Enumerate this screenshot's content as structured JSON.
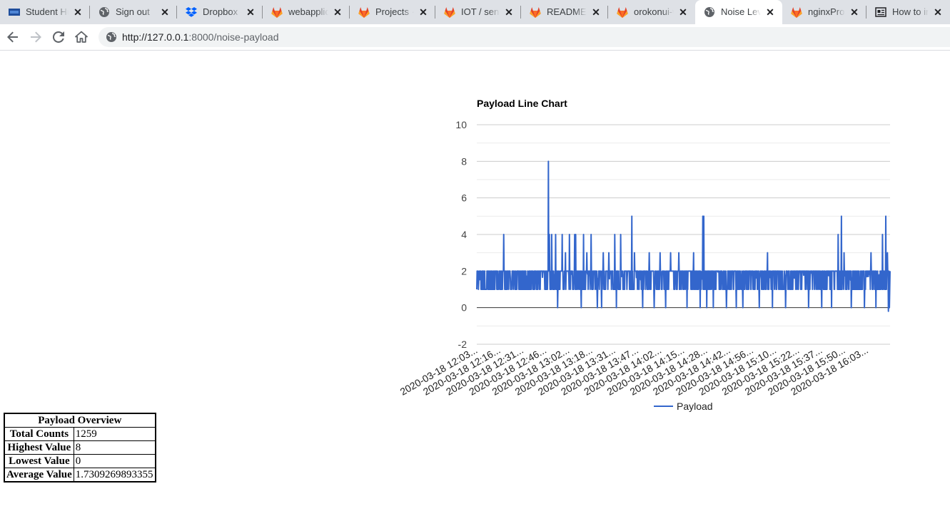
{
  "tabs": [
    {
      "title": "Student Hub",
      "icon": "student-hub-icon"
    },
    {
      "title": "Sign out",
      "icon": "globe-icon"
    },
    {
      "title": "Dropbox - ",
      "icon": "dropbox-icon"
    },
    {
      "title": "webapplication",
      "icon": "gitlab-icon"
    },
    {
      "title": "Projects · Dashboard",
      "icon": "gitlab-icon"
    },
    {
      "title": "IOT / sensor",
      "icon": "gitlab-icon"
    },
    {
      "title": "README.md",
      "icon": "gitlab-icon"
    },
    {
      "title": "orokonui-web",
      "icon": "gitlab-icon"
    },
    {
      "title": "Noise Level",
      "icon": "globe-icon",
      "active": true
    },
    {
      "title": "nginxProxy",
      "icon": "gitlab-icon"
    },
    {
      "title": "How to install",
      "icon": "reader-icon"
    }
  ],
  "address": {
    "host": "http://127.0.0.1",
    "path": ":8000/noise-payload"
  },
  "chart_data": {
    "type": "line",
    "title": "Payload Line Chart",
    "ylim": [
      -2,
      10
    ],
    "yticks": [
      "10",
      "8",
      "6",
      "4",
      "2",
      "0",
      "-2"
    ],
    "grid": true,
    "legend_position": "bottom",
    "x_tick_labels": [
      "2020-03-18 12:03...",
      "2020-03-18 12:16...",
      "2020-03-18 12:31...",
      "2020-03-18 12:46...",
      "2020-03-18 13:02...",
      "2020-03-18 13:18...",
      "2020-03-18 13:31...",
      "2020-03-18 13:47...",
      "2020-03-18 14:02...",
      "2020-03-18 14:15...",
      "2020-03-18 14:28...",
      "2020-03-18 14:42...",
      "2020-03-18 14:56...",
      "2020-03-18 15:10...",
      "2020-03-18 15:22...",
      "2020-03-18 15:37...",
      "2020-03-18 15:50...",
      "2020-03-18 16:03..."
    ],
    "point_count": 1259,
    "series": [
      {
        "name": "Payload",
        "color": "#3366cc",
        "baseline_values": [
          1,
          2
        ],
        "spikes": [
          {
            "index": 82,
            "value": 4
          },
          {
            "index": 218,
            "value": 8
          },
          {
            "index": 221,
            "value": 4
          },
          {
            "index": 228,
            "value": 4
          },
          {
            "index": 240,
            "value": 4
          },
          {
            "index": 246,
            "value": 0
          },
          {
            "index": 260,
            "value": 4
          },
          {
            "index": 270,
            "value": 3
          },
          {
            "index": 282,
            "value": 4
          },
          {
            "index": 298,
            "value": 4
          },
          {
            "index": 301,
            "value": 4
          },
          {
            "index": 318,
            "value": 0
          },
          {
            "index": 325,
            "value": 4
          },
          {
            "index": 335,
            "value": 3
          },
          {
            "index": 348,
            "value": 4
          },
          {
            "index": 367,
            "value": 0
          },
          {
            "index": 380,
            "value": 0
          },
          {
            "index": 385,
            "value": 3
          },
          {
            "index": 402,
            "value": 3
          },
          {
            "index": 420,
            "value": 4
          },
          {
            "index": 425,
            "value": 0
          },
          {
            "index": 438,
            "value": 4
          },
          {
            "index": 472,
            "value": 5
          },
          {
            "index": 480,
            "value": 3
          },
          {
            "index": 505,
            "value": 0
          },
          {
            "index": 525,
            "value": 3
          },
          {
            "index": 540,
            "value": 0
          },
          {
            "index": 558,
            "value": 3
          },
          {
            "index": 575,
            "value": 0
          },
          {
            "index": 590,
            "value": 3
          },
          {
            "index": 615,
            "value": 3
          },
          {
            "index": 640,
            "value": 0
          },
          {
            "index": 660,
            "value": 3
          },
          {
            "index": 680,
            "value": 0
          },
          {
            "index": 688,
            "value": 5
          },
          {
            "index": 691,
            "value": 5
          },
          {
            "index": 700,
            "value": 0
          },
          {
            "index": 720,
            "value": 0
          },
          {
            "index": 760,
            "value": 0
          },
          {
            "index": 790,
            "value": 0
          },
          {
            "index": 810,
            "value": 0
          },
          {
            "index": 860,
            "value": 0
          },
          {
            "index": 885,
            "value": 3
          },
          {
            "index": 900,
            "value": 0
          },
          {
            "index": 940,
            "value": 0
          },
          {
            "index": 1010,
            "value": 0
          },
          {
            "index": 1050,
            "value": 0
          },
          {
            "index": 1080,
            "value": 0
          },
          {
            "index": 1100,
            "value": 4
          },
          {
            "index": 1110,
            "value": 5
          },
          {
            "index": 1118,
            "value": 3
          },
          {
            "index": 1140,
            "value": 0
          },
          {
            "index": 1180,
            "value": 0
          },
          {
            "index": 1200,
            "value": 3
          },
          {
            "index": 1215,
            "value": 0
          },
          {
            "index": 1235,
            "value": 4
          },
          {
            "index": 1245,
            "value": 5
          },
          {
            "index": 1250,
            "value": 3
          },
          {
            "index": 1253,
            "value": -0.2
          },
          {
            "index": 1256,
            "value": 0
          }
        ]
      }
    ]
  },
  "overview": {
    "title": "Payload Overview",
    "rows": [
      {
        "label": "Total Counts",
        "value": "1259"
      },
      {
        "label": "Highest Value",
        "value": "8"
      },
      {
        "label": "Lowest Value",
        "value": "0"
      },
      {
        "label": "Average Value",
        "value": "1.7309269893355"
      }
    ]
  }
}
